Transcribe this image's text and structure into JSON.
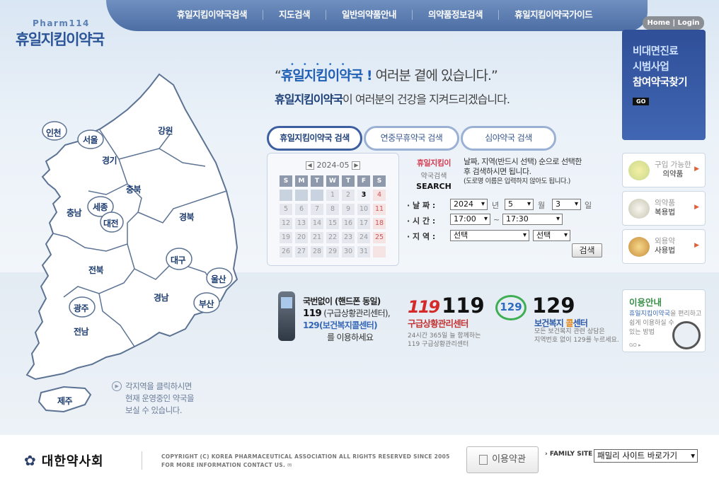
{
  "nav": {
    "items": [
      "휴일지킴이약국검색",
      "지도검색",
      "일반의약품안내",
      "의약품정보검색",
      "휴일지킴이약국가이드"
    ]
  },
  "logo": {
    "en": "Pharm114",
    "kr": "휴일지킴이약국"
  },
  "header": {
    "home_login": "Home | Login"
  },
  "promo": {
    "line1": "비대면진료",
    "line2": "시범사업",
    "line3": "참여약국찾기",
    "go": "GO"
  },
  "slogan": {
    "l1_quote_open": "“",
    "l1_bold": "휴일지킴이약국 !",
    "l1_rest": " 여러분 곁에 있습니다.”",
    "l2_bold": "휴일지킴이약국",
    "l2_rest": "이 여러분의 건강을 지켜드리겠습니다."
  },
  "tabs": [
    "휴일지킴이약국 검색",
    "연중무휴약국 검색",
    "심야약국 검색"
  ],
  "calendar": {
    "month": "2024-05",
    "days_of_week": [
      "S",
      "M",
      "T",
      "W",
      "T",
      "F",
      "S"
    ],
    "weeks": [
      [
        "",
        "",
        "",
        "1",
        "2",
        "3",
        "4"
      ],
      [
        "5",
        "6",
        "7",
        "8",
        "9",
        "10",
        "11"
      ],
      [
        "12",
        "13",
        "14",
        "15",
        "16",
        "17",
        "18"
      ],
      [
        "19",
        "20",
        "21",
        "22",
        "23",
        "24",
        "25"
      ],
      [
        "26",
        "27",
        "28",
        "29",
        "30",
        "31",
        ""
      ]
    ],
    "today": "3"
  },
  "search": {
    "label1": "휴일지킴이",
    "label2": "약국검색",
    "label3": "SEARCH",
    "instr1": "날짜, 지역(반드시 선택) 순으로 선택한",
    "instr2": "후 검색하시면 됩니다.",
    "instr3": "(도로명 이름은 입력하지 않아도 됩니다.)",
    "date_label": "· 날 짜 :",
    "year": "2024",
    "year_unit": "년",
    "month": "5",
    "month_unit": "월",
    "day": "3",
    "day_unit": "일",
    "time_label": "· 시 간 :",
    "time_from": "17:00",
    "time_sep": "~",
    "time_to": "17:30",
    "region_label": "· 지 역 :",
    "region1": "선택",
    "region2": "선택",
    "button": "검색"
  },
  "side": [
    {
      "line1": "구입 가능한",
      "line2": "의약품"
    },
    {
      "line1": "의약품",
      "line2": "복용법"
    },
    {
      "line1": "외용약",
      "line2": "사용법"
    }
  ],
  "map": {
    "regions": [
      "인천",
      "서울",
      "강원",
      "경기",
      "충북",
      "세종",
      "충남",
      "대전",
      "경북",
      "대구",
      "전북",
      "울산",
      "경남",
      "광주",
      "부산",
      "전남",
      "제주"
    ],
    "note1": "각지역을 클릭하시면",
    "note2": "현재 운영중인 약국을",
    "note3": "보실 수 있습니다."
  },
  "emergency": {
    "l1": "국번없이 (핸드폰 동일)",
    "l2_num": "119",
    "l2_rest": " (구급상황관리센터),",
    "l3": "129(보건복지콜센터)",
    "l4": "를 이용하세요",
    "n119_logo": "119",
    "n119_num": "119",
    "n119_name": "구급상황관리센터",
    "n119_d1": "24시간 365일 늘 함께하는",
    "n119_d2": "119 구급상황관리센터",
    "n129_logo": "129",
    "n129_num": "129",
    "n129_name_a": "보건복지 ",
    "n129_name_b": "콜",
    "n129_name_c": "센터",
    "n129_d1": "모든 보건복지 관련 상담은",
    "n129_d2": "지역번호 없이 129를 누르세요."
  },
  "guide": {
    "title": "이용안내",
    "d1_b": "휴일지킴이약국",
    "d1": "을 편리하고",
    "d2": "쉽게 이용하실 수",
    "d3": "있는 방법",
    "go": "GO ▸"
  },
  "footer": {
    "org": "대한약사회",
    "copy1": "COPYRIGHT (C) KOREA PHARMACEUTICAL ASSOCIATION ALL RIGHTS RESERVED SINCE 2005",
    "copy2": "FOR MORE INFORMATION CONTACT US.",
    "terms": "이용약관",
    "family_label": "FAMILY SITE",
    "family_select": "패밀리 사이트 바로가기"
  }
}
